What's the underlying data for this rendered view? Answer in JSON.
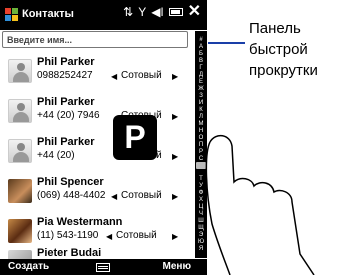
{
  "titlebar": {
    "title": "Контакты"
  },
  "search": {
    "placeholder": "Введите имя..."
  },
  "contacts": [
    {
      "name": "Phil Parker",
      "phone": "0988252427",
      "type": "Сотовый"
    },
    {
      "name": "Phil Parker",
      "phone": "+44 (20) 7946",
      "type": "Сотовый"
    },
    {
      "name": "Phil Parker",
      "phone": "+44 (20)",
      "type": "Сотовый"
    },
    {
      "name": "Phil Spencer",
      "phone": "(069) 448-4402",
      "type": "Сотовый"
    },
    {
      "name": "Pia Westermann",
      "phone": "(11) 543-1190",
      "type": "Сотовый"
    },
    {
      "name": "Pieter Budai",
      "phone": "",
      "type": ""
    }
  ],
  "scrollbar": {
    "letters": [
      "#",
      "А",
      "Б",
      "В",
      "Г",
      "Д",
      "Е",
      "Ж",
      "З",
      "И",
      "К",
      "Л",
      "М",
      "Н",
      "О",
      "П",
      "Р",
      "С",
      "Т",
      "У",
      "Ф",
      "Х",
      "Ц",
      "Ч",
      "Ш",
      "Щ",
      "Э",
      "Ю",
      "Я"
    ],
    "active_letter": "Р"
  },
  "overlay": {
    "letter": "P"
  },
  "softkeys": {
    "left": "Создать",
    "right": "Меню"
  },
  "callout": {
    "lines": [
      "Панель",
      "быстрой",
      "прокрутки"
    ]
  },
  "colors": {
    "callout_line": "#1a3fa8",
    "bar_bg": "#000000"
  },
  "icons": [
    "windows-logo-icon",
    "signal-icon",
    "volume-icon",
    "battery-icon",
    "close-icon",
    "keyboard-icon"
  ]
}
